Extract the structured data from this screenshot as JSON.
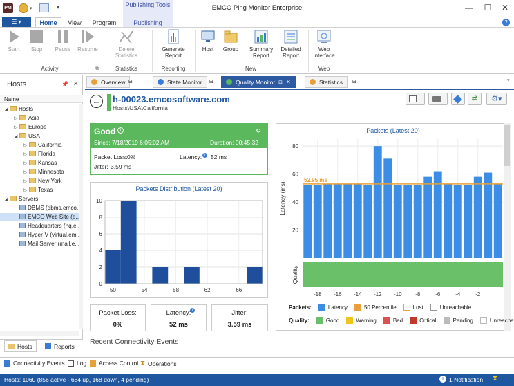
{
  "app": {
    "title": "EMCO Ping Monitor Enterprise",
    "context_tab_group": "Publishing Tools",
    "app_badge": "PM"
  },
  "ribbon_tabs": [
    {
      "label": "Home",
      "active": true
    },
    {
      "label": "View"
    },
    {
      "label": "Program"
    },
    {
      "label": "Publishing"
    }
  ],
  "ribbon": {
    "buttons": {
      "start": "Start",
      "stop": "Stop",
      "pause": "Pause",
      "resume": "Resume",
      "delete_statistics": "Delete Statistics",
      "generate_report": "Generate Report",
      "host": "Host",
      "group": "Group",
      "summary_report": "Summary Report",
      "detailed_report": "Detailed Report",
      "web_interface": "Web Interface"
    },
    "groups": {
      "activity": "Activity",
      "statistics": "Statistics",
      "reporting": "Reporting",
      "new": "New",
      "web": "Web"
    }
  },
  "hosts_pane": {
    "title": "Hosts",
    "column": "Name",
    "tree": [
      {
        "label": "Hosts",
        "level": 0,
        "type": "folder",
        "expanded": true
      },
      {
        "label": "Asia",
        "level": 1,
        "type": "folder"
      },
      {
        "label": "Europe",
        "level": 1,
        "type": "folder"
      },
      {
        "label": "USA",
        "level": 1,
        "type": "folder",
        "expanded": true
      },
      {
        "label": "California",
        "level": 2,
        "type": "folder"
      },
      {
        "label": "Florida",
        "level": 2,
        "type": "folder"
      },
      {
        "label": "Kansas",
        "level": 2,
        "type": "folder"
      },
      {
        "label": "Minnesota",
        "level": 2,
        "type": "folder"
      },
      {
        "label": "New York",
        "level": 2,
        "type": "folder"
      },
      {
        "label": "Texas",
        "level": 2,
        "type": "folder"
      },
      {
        "label": "Servers",
        "level": 0,
        "type": "folder",
        "expanded": true
      },
      {
        "label": "DBMS (dbms.emco...",
        "level": 1,
        "type": "host"
      },
      {
        "label": "EMCO Web Site (e...",
        "level": 1,
        "type": "host",
        "selected": true
      },
      {
        "label": "Headquarters (hq.e...",
        "level": 1,
        "type": "host"
      },
      {
        "label": "Hyper-V (virtual.em...",
        "level": 1,
        "type": "host"
      },
      {
        "label": "Mail Server (mail.e...",
        "level": 1,
        "type": "host"
      }
    ],
    "bottom_tabs": {
      "hosts": "Hosts",
      "reports": "Reports"
    }
  },
  "doc_tabs": [
    {
      "label": "Overview",
      "color": "#e8a13a"
    },
    {
      "label": "State Monitor",
      "color": "#3a7bd5"
    },
    {
      "label": "Quality Monitor",
      "color": "#5cb85c",
      "active": true
    },
    {
      "label": "Statistics",
      "color": "#e8a13a"
    }
  ],
  "host_header": {
    "name": "h-00023.emcosoftware.com",
    "path": "Hosts\\USA\\California"
  },
  "status": {
    "state": "Good",
    "since_label": "Since: 7/18/2019 6:05:02 AM",
    "duration_label": "Duration: 00:45:32",
    "packet_loss_label": "Packet Loss:",
    "packet_loss_value": "0%",
    "latency_label": "Latency:",
    "latency_value": "52 ms",
    "jitter_label": "Jitter:",
    "jitter_value": "3.59 ms",
    "color": "#5cb85c"
  },
  "metrics": [
    {
      "label": "Packet Loss:",
      "value": "0%"
    },
    {
      "label": "Latency:",
      "value": "52 ms"
    },
    {
      "label": "Jitter:",
      "value": "3.59 ms"
    }
  ],
  "recent_events_title": "Recent Connectivity Events",
  "chart_data": [
    {
      "type": "bar",
      "title": "Packets Distribution (Latest 20)",
      "bins": [
        {
          "from": 49,
          "to": 51,
          "count": 4
        },
        {
          "from": 51,
          "to": 53,
          "count": 10
        },
        {
          "from": 55,
          "to": 57,
          "count": 2
        },
        {
          "from": 59,
          "to": 61,
          "count": 2
        },
        {
          "from": 67,
          "to": 69,
          "count": 2
        }
      ],
      "xlim": [
        49,
        69
      ],
      "xticks": [
        50,
        54,
        58,
        62,
        66
      ],
      "ylim": [
        0,
        10
      ],
      "yticks": [
        0,
        2,
        4,
        6,
        8,
        10
      ],
      "color": "#1e4e9c",
      "grid": true
    },
    {
      "type": "bar",
      "title": "Packets (Latest 20)",
      "ylabel": "Latency (ms)",
      "x": [
        -19,
        -18,
        -17,
        -16,
        -15,
        -14,
        -13,
        -12,
        -11,
        -10,
        -9,
        -8,
        -7,
        -6,
        -5,
        -4,
        -3,
        -2,
        -1
      ],
      "values": [
        52,
        52,
        53,
        53,
        53,
        53,
        52,
        80,
        71,
        52,
        52,
        52,
        58,
        62,
        53,
        52,
        52,
        58,
        61,
        53
      ],
      "x_all": [
        -19,
        -18,
        -17,
        -16,
        -15,
        -14,
        -13,
        -12,
        -11,
        -10,
        -9,
        -8,
        -7,
        -6,
        -5,
        -4,
        -3,
        -2,
        -1,
        0
      ],
      "percentile_50": 52.95,
      "percentile_label": "52.95 ms",
      "xticks": [
        -18,
        -16,
        -14,
        -12,
        -10,
        -8,
        -6,
        -4,
        -2
      ],
      "ylim": [
        0,
        85
      ],
      "yticks": [
        20,
        40,
        60,
        80
      ],
      "bar_color": "#3c8de6",
      "percentile_color": "#e8a13a",
      "quality_label": "Quality",
      "quality_color": "#6abf69",
      "grid": true,
      "legend": {
        "packets_label": "Packets:",
        "packets": [
          {
            "name": "Latency",
            "color": "#3c8de6"
          },
          {
            "name": "50 Percentile",
            "color": "#e8a13a"
          },
          {
            "name": "Lost",
            "color": "#ffffff",
            "border": "#e8a13a"
          },
          {
            "name": "Unreachable",
            "color": "#ffffff",
            "border": "#999999"
          }
        ],
        "quality_label": "Quality:",
        "quality": [
          {
            "name": "Good",
            "color": "#6abf69"
          },
          {
            "name": "Warning",
            "color": "#f0c419"
          },
          {
            "name": "Bad",
            "color": "#d9534f"
          },
          {
            "name": "Critical",
            "color": "#c0392b"
          },
          {
            "name": "Pending",
            "color": "#bbbbbb"
          },
          {
            "name": "Unreachable",
            "color": "#ffffff",
            "border": "#bbbbbb"
          }
        ]
      }
    }
  ],
  "bottom_panel_tabs": [
    {
      "label": "Connectivity Events"
    },
    {
      "label": "Log"
    },
    {
      "label": "Access Control"
    },
    {
      "label": "Operations"
    }
  ],
  "statusbar": {
    "left": "Hosts: 1060 (856 active - 684 up, 168 down, 4 pending)",
    "notification": "1 Notification"
  }
}
